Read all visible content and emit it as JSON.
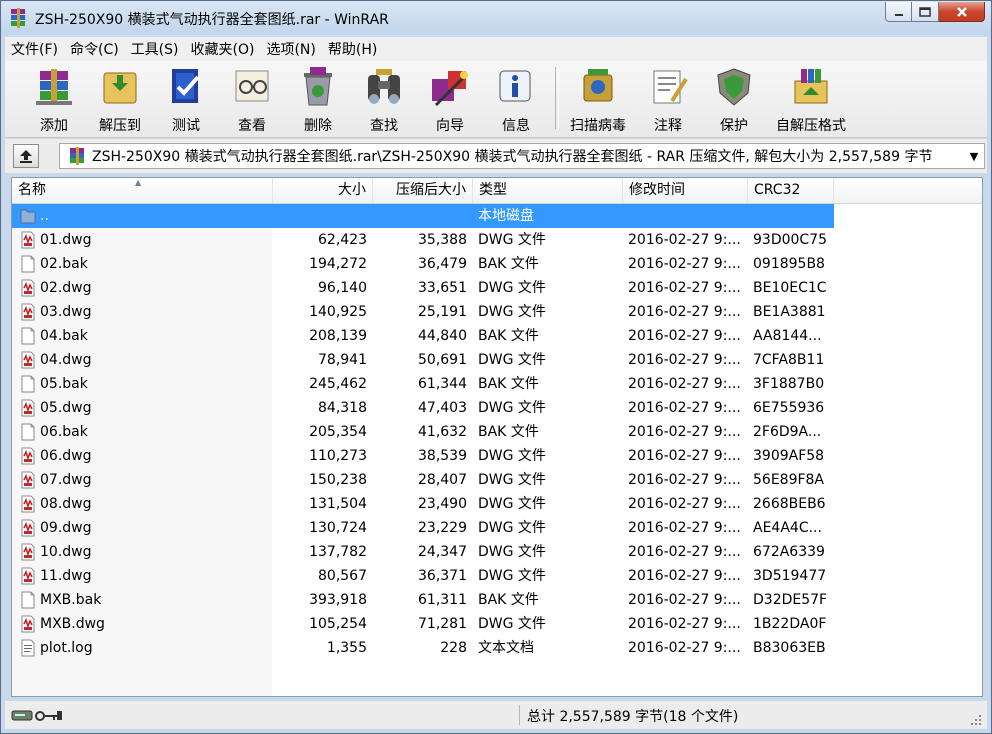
{
  "window": {
    "title": "ZSH-250X90 横装式气动执行器全套图纸.rar - WinRAR",
    "controls": {
      "minimize": "minimize-icon",
      "maximize": "maximize-icon",
      "close": "close-icon"
    }
  },
  "menu": [
    {
      "label": "文件(F)"
    },
    {
      "label": "命令(C)"
    },
    {
      "label": "工具(S)"
    },
    {
      "label": "收藏夹(O)"
    },
    {
      "label": "选项(N)"
    },
    {
      "label": "帮助(H)"
    }
  ],
  "toolbar": [
    {
      "label": "添加",
      "icon": "add-icon"
    },
    {
      "label": "解压到",
      "icon": "extract-icon"
    },
    {
      "label": "测试",
      "icon": "test-icon"
    },
    {
      "label": "查看",
      "icon": "view-icon"
    },
    {
      "label": "删除",
      "icon": "delete-icon"
    },
    {
      "label": "查找",
      "icon": "find-icon"
    },
    {
      "label": "向导",
      "icon": "wizard-icon"
    },
    {
      "label": "信息",
      "icon": "info-icon"
    },
    {
      "label": "扫描病毒",
      "icon": "virus-scan-icon"
    },
    {
      "label": "注释",
      "icon": "comment-icon"
    },
    {
      "label": "保护",
      "icon": "protect-icon"
    },
    {
      "label": "自解压格式",
      "icon": "sfx-icon"
    }
  ],
  "address": {
    "path": "ZSH-250X90 横装式气动执行器全套图纸.rar\\ZSH-250X90 横装式气动执行器全套图纸 - RAR 压缩文件, 解包大小为 2,557,589 字节"
  },
  "columns": {
    "name": "名称",
    "size": "大小",
    "packed": "压缩后大小",
    "type": "类型",
    "modified": "修改时间",
    "crc": "CRC32"
  },
  "files": [
    {
      "name": "..",
      "size": "",
      "packed": "",
      "type": "本地磁盘",
      "modified": "",
      "crc": "",
      "icon": "folder-icon",
      "selected": true
    },
    {
      "name": "01.dwg",
      "size": "62,423",
      "packed": "35,388",
      "type": "DWG 文件",
      "modified": "2016-02-27 9:...",
      "crc": "93D00C75",
      "icon": "dwg-file-icon"
    },
    {
      "name": "02.bak",
      "size": "194,272",
      "packed": "36,479",
      "type": "BAK 文件",
      "modified": "2016-02-27 9:...",
      "crc": "091895B8",
      "icon": "blank-file-icon"
    },
    {
      "name": "02.dwg",
      "size": "96,140",
      "packed": "33,651",
      "type": "DWG 文件",
      "modified": "2016-02-27 9:...",
      "crc": "BE10EC1C",
      "icon": "dwg-file-icon"
    },
    {
      "name": "03.dwg",
      "size": "140,925",
      "packed": "25,191",
      "type": "DWG 文件",
      "modified": "2016-02-27 9:...",
      "crc": "BE1A3881",
      "icon": "dwg-file-icon"
    },
    {
      "name": "04.bak",
      "size": "208,139",
      "packed": "44,840",
      "type": "BAK 文件",
      "modified": "2016-02-27 9:...",
      "crc": "AA8144...",
      "icon": "blank-file-icon"
    },
    {
      "name": "04.dwg",
      "size": "78,941",
      "packed": "50,691",
      "type": "DWG 文件",
      "modified": "2016-02-27 9:...",
      "crc": "7CFA8B11",
      "icon": "dwg-file-icon"
    },
    {
      "name": "05.bak",
      "size": "245,462",
      "packed": "61,344",
      "type": "BAK 文件",
      "modified": "2016-02-27 9:...",
      "crc": "3F1887B0",
      "icon": "blank-file-icon"
    },
    {
      "name": "05.dwg",
      "size": "84,318",
      "packed": "47,403",
      "type": "DWG 文件",
      "modified": "2016-02-27 9:...",
      "crc": "6E755936",
      "icon": "dwg-file-icon"
    },
    {
      "name": "06.bak",
      "size": "205,354",
      "packed": "41,632",
      "type": "BAK 文件",
      "modified": "2016-02-27 9:...",
      "crc": "2F6D9A...",
      "icon": "blank-file-icon"
    },
    {
      "name": "06.dwg",
      "size": "110,273",
      "packed": "38,539",
      "type": "DWG 文件",
      "modified": "2016-02-27 9:...",
      "crc": "3909AF58",
      "icon": "dwg-file-icon"
    },
    {
      "name": "07.dwg",
      "size": "150,238",
      "packed": "28,407",
      "type": "DWG 文件",
      "modified": "2016-02-27 9:...",
      "crc": "56E89F8A",
      "icon": "dwg-file-icon"
    },
    {
      "name": "08.dwg",
      "size": "131,504",
      "packed": "23,490",
      "type": "DWG 文件",
      "modified": "2016-02-27 9:...",
      "crc": "2668BEB6",
      "icon": "dwg-file-icon"
    },
    {
      "name": "09.dwg",
      "size": "130,724",
      "packed": "23,229",
      "type": "DWG 文件",
      "modified": "2016-02-27 9:...",
      "crc": "AE4A4C...",
      "icon": "dwg-file-icon"
    },
    {
      "name": "10.dwg",
      "size": "137,782",
      "packed": "24,347",
      "type": "DWG 文件",
      "modified": "2016-02-27 9:...",
      "crc": "672A6339",
      "icon": "dwg-file-icon"
    },
    {
      "name": "11.dwg",
      "size": "80,567",
      "packed": "36,371",
      "type": "DWG 文件",
      "modified": "2016-02-27 9:...",
      "crc": "3D519477",
      "icon": "dwg-file-icon"
    },
    {
      "name": "MXB.bak",
      "size": "393,918",
      "packed": "61,311",
      "type": "BAK 文件",
      "modified": "2016-02-27 9:...",
      "crc": "D32DE57F",
      "icon": "blank-file-icon"
    },
    {
      "name": "MXB.dwg",
      "size": "105,254",
      "packed": "71,281",
      "type": "DWG 文件",
      "modified": "2016-02-27 9:...",
      "crc": "1B22DA0F",
      "icon": "dwg-file-icon"
    },
    {
      "name": "plot.log",
      "size": "1,355",
      "packed": "228",
      "type": "文本文档",
      "modified": "2016-02-27 9:...",
      "crc": "B83063EB",
      "icon": "text-file-icon"
    }
  ],
  "status": {
    "summary": "总计 2,557,589 字节(18 个文件)",
    "left_icons": [
      "drive-icon",
      "key-icon"
    ]
  },
  "colors": {
    "selection": "#3399ff",
    "close_button": "#c9462c"
  }
}
